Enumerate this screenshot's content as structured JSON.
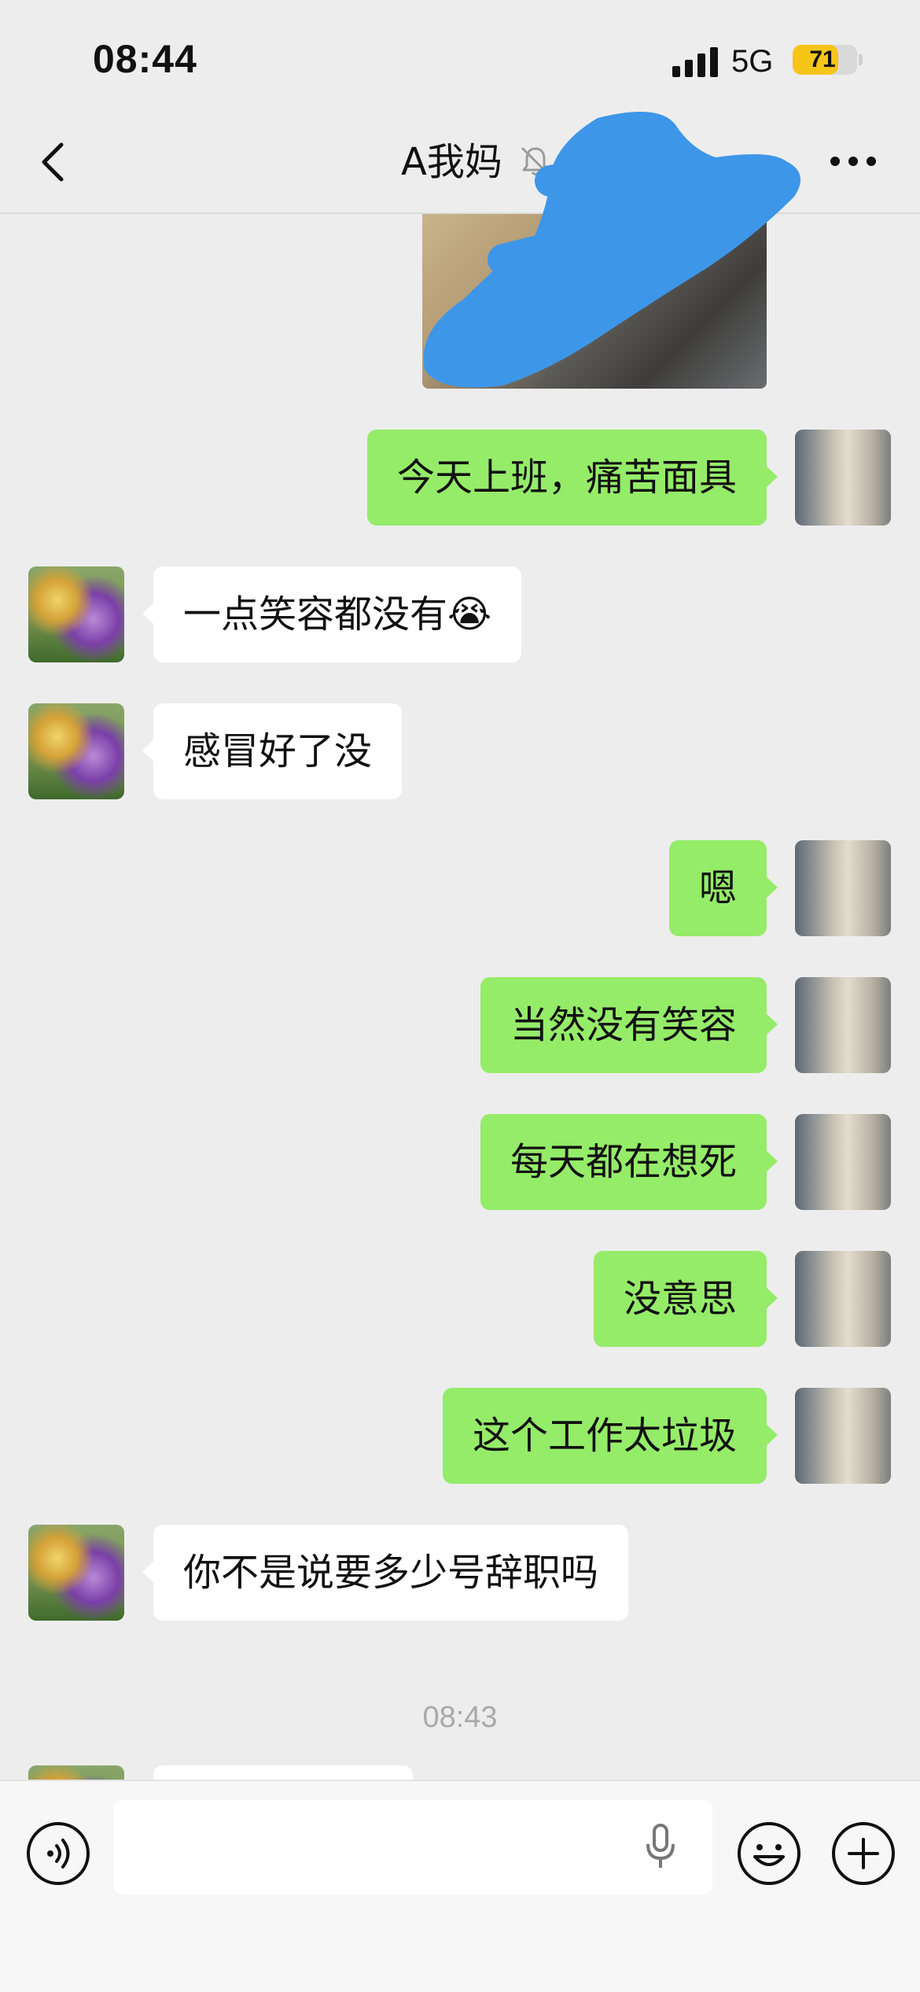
{
  "status_bar": {
    "time": "08:44",
    "network": "5G",
    "battery": "71",
    "battery_level_percent": 71
  },
  "nav": {
    "title": "A我妈",
    "back_icon": "chevron-left-icon",
    "mute_icon": "bell-slash-icon",
    "more_icon": "ellipsis-icon"
  },
  "messages": [
    {
      "from": "me",
      "text": "今天上班，痛苦面具"
    },
    {
      "from": "other",
      "text": "一点笑容都没有😭"
    },
    {
      "from": "other",
      "text": "感冒好了没"
    },
    {
      "from": "me",
      "text": "嗯"
    },
    {
      "from": "me",
      "text": "当然没有笑容"
    },
    {
      "from": "me",
      "text": "每天都在想死"
    },
    {
      "from": "me",
      "text": "没意思"
    },
    {
      "from": "me",
      "text": "这个工作太垃圾"
    },
    {
      "from": "other",
      "text": "你不是说要多少号辞职吗"
    }
  ],
  "timestamp": "08:43",
  "input_bar": {
    "voice_icon": "voice-icon",
    "input_value": "",
    "mic_icon": "microphone-icon",
    "emoji_icon": "emoji-icon",
    "plus_icon": "plus-icon"
  },
  "colors": {
    "background": "#ededed",
    "my_bubble": "#95ec69",
    "other_bubble": "#ffffff",
    "battery_accent": "#f5c518",
    "redaction": "#3d96e8"
  }
}
